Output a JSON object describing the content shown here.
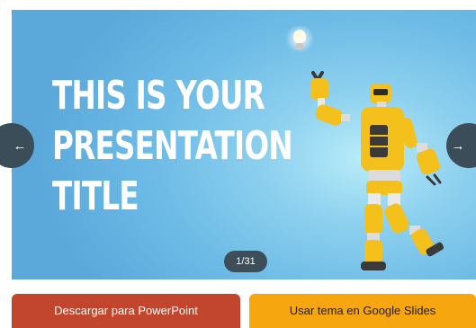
{
  "slide": {
    "title_lines": [
      "THIS IS YOUR",
      "PRESENTATION",
      "TITLE"
    ],
    "counter": "1/31"
  },
  "nav": {
    "prev_glyph": "←",
    "next_glyph": "→"
  },
  "actions": {
    "powerpoint_label": "Descargar para PowerPoint",
    "google_slides_label": "Usar tema en Google Slides"
  },
  "colors": {
    "powerpoint_button": "#c2452d",
    "google_slides_button": "#f6a60f",
    "slide_background": "#6dbbe6",
    "robot_body": "#f4c01c"
  },
  "icons": [
    "arrow-left-icon",
    "arrow-right-icon",
    "lightbulb-icon"
  ]
}
